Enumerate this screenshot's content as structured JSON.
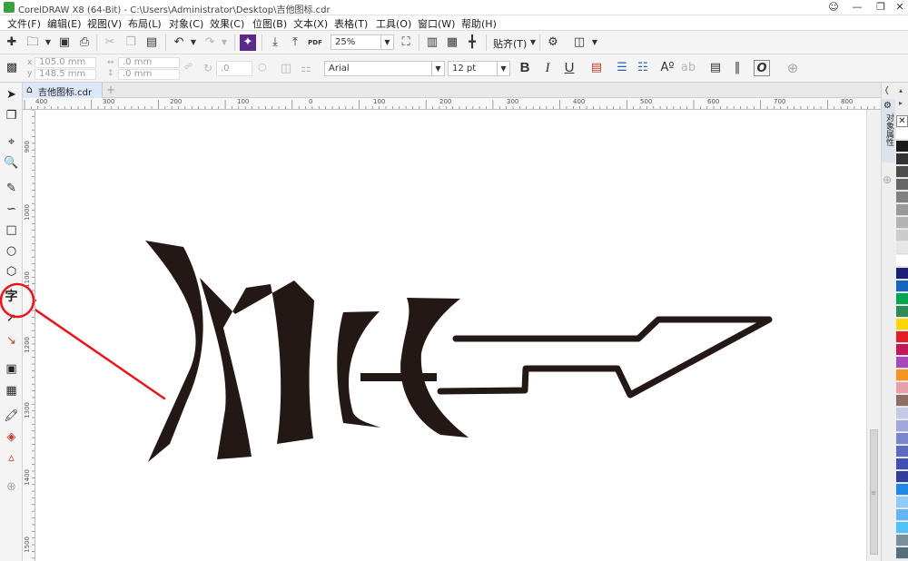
{
  "app": {
    "title": "CorelDRAW X8 (64-Bit) - C:\\Users\\Administrator\\Desktop\\吉他图标.cdr",
    "window_controls": [
      "person-icon",
      "minimize-icon",
      "restore-icon",
      "close-icon"
    ]
  },
  "menu": [
    "文件(F)",
    "编辑(E)",
    "视图(V)",
    "布局(L)",
    "对象(C)",
    "效果(C)",
    "位图(B)",
    "文本(X)",
    "表格(T)",
    "工具(O)",
    "窗口(W)",
    "帮助(H)"
  ],
  "toolbar1": {
    "zoom": "25%",
    "pdf_label": "PDF",
    "snap_label": "贴齐(T)"
  },
  "toolbar2": {
    "x_value": "105.0 mm",
    "y_value": "148.5 mm",
    "width_value": ".0 mm",
    "height_value": ".0 mm",
    "angle_value": ".0",
    "font_name": "Arial",
    "font_size": "12 pt",
    "bold_label": "B",
    "italic_label": "I",
    "underline_label": "U"
  },
  "document": {
    "tab_label": "吉他图标.cdr",
    "add_tab": "+"
  },
  "rulers": {
    "horizontal_ticks": [
      "400",
      "300",
      "200",
      "100",
      "0",
      "100",
      "200",
      "300",
      "400",
      "500",
      "600",
      "700",
      "800"
    ],
    "vertical_ticks": [
      "900",
      "1000",
      "1100",
      "1200",
      "1300",
      "1400",
      "1500"
    ]
  },
  "docker": {
    "label": "对象属性"
  },
  "palette_colors": [
    "#ffffff",
    "#1a1a1a",
    "#333333",
    "#4d4d4d",
    "#666666",
    "#808080",
    "#999999",
    "#b3b3b3",
    "#cccccc",
    "#e6e6e6",
    "#ffffff",
    "#1f1f7a",
    "#1565c0",
    "#00a651",
    "#2e8b57",
    "#ffd600",
    "#e31e24",
    "#c2185b",
    "#ab47bc",
    "#f7941d",
    "#e8a0a8",
    "#8d6e63",
    "#c5cae9",
    "#9fa8da",
    "#7986cb",
    "#5c6bc0",
    "#3f51b5",
    "#303f9f",
    "#1e88e5",
    "#90caf9",
    "#64b5f6",
    "#4fc3f7",
    "#78909c",
    "#546e7a"
  ],
  "colors": {
    "artwork": "#231815",
    "annotation": "#e8161c",
    "tab_active": "#dce8f7"
  }
}
